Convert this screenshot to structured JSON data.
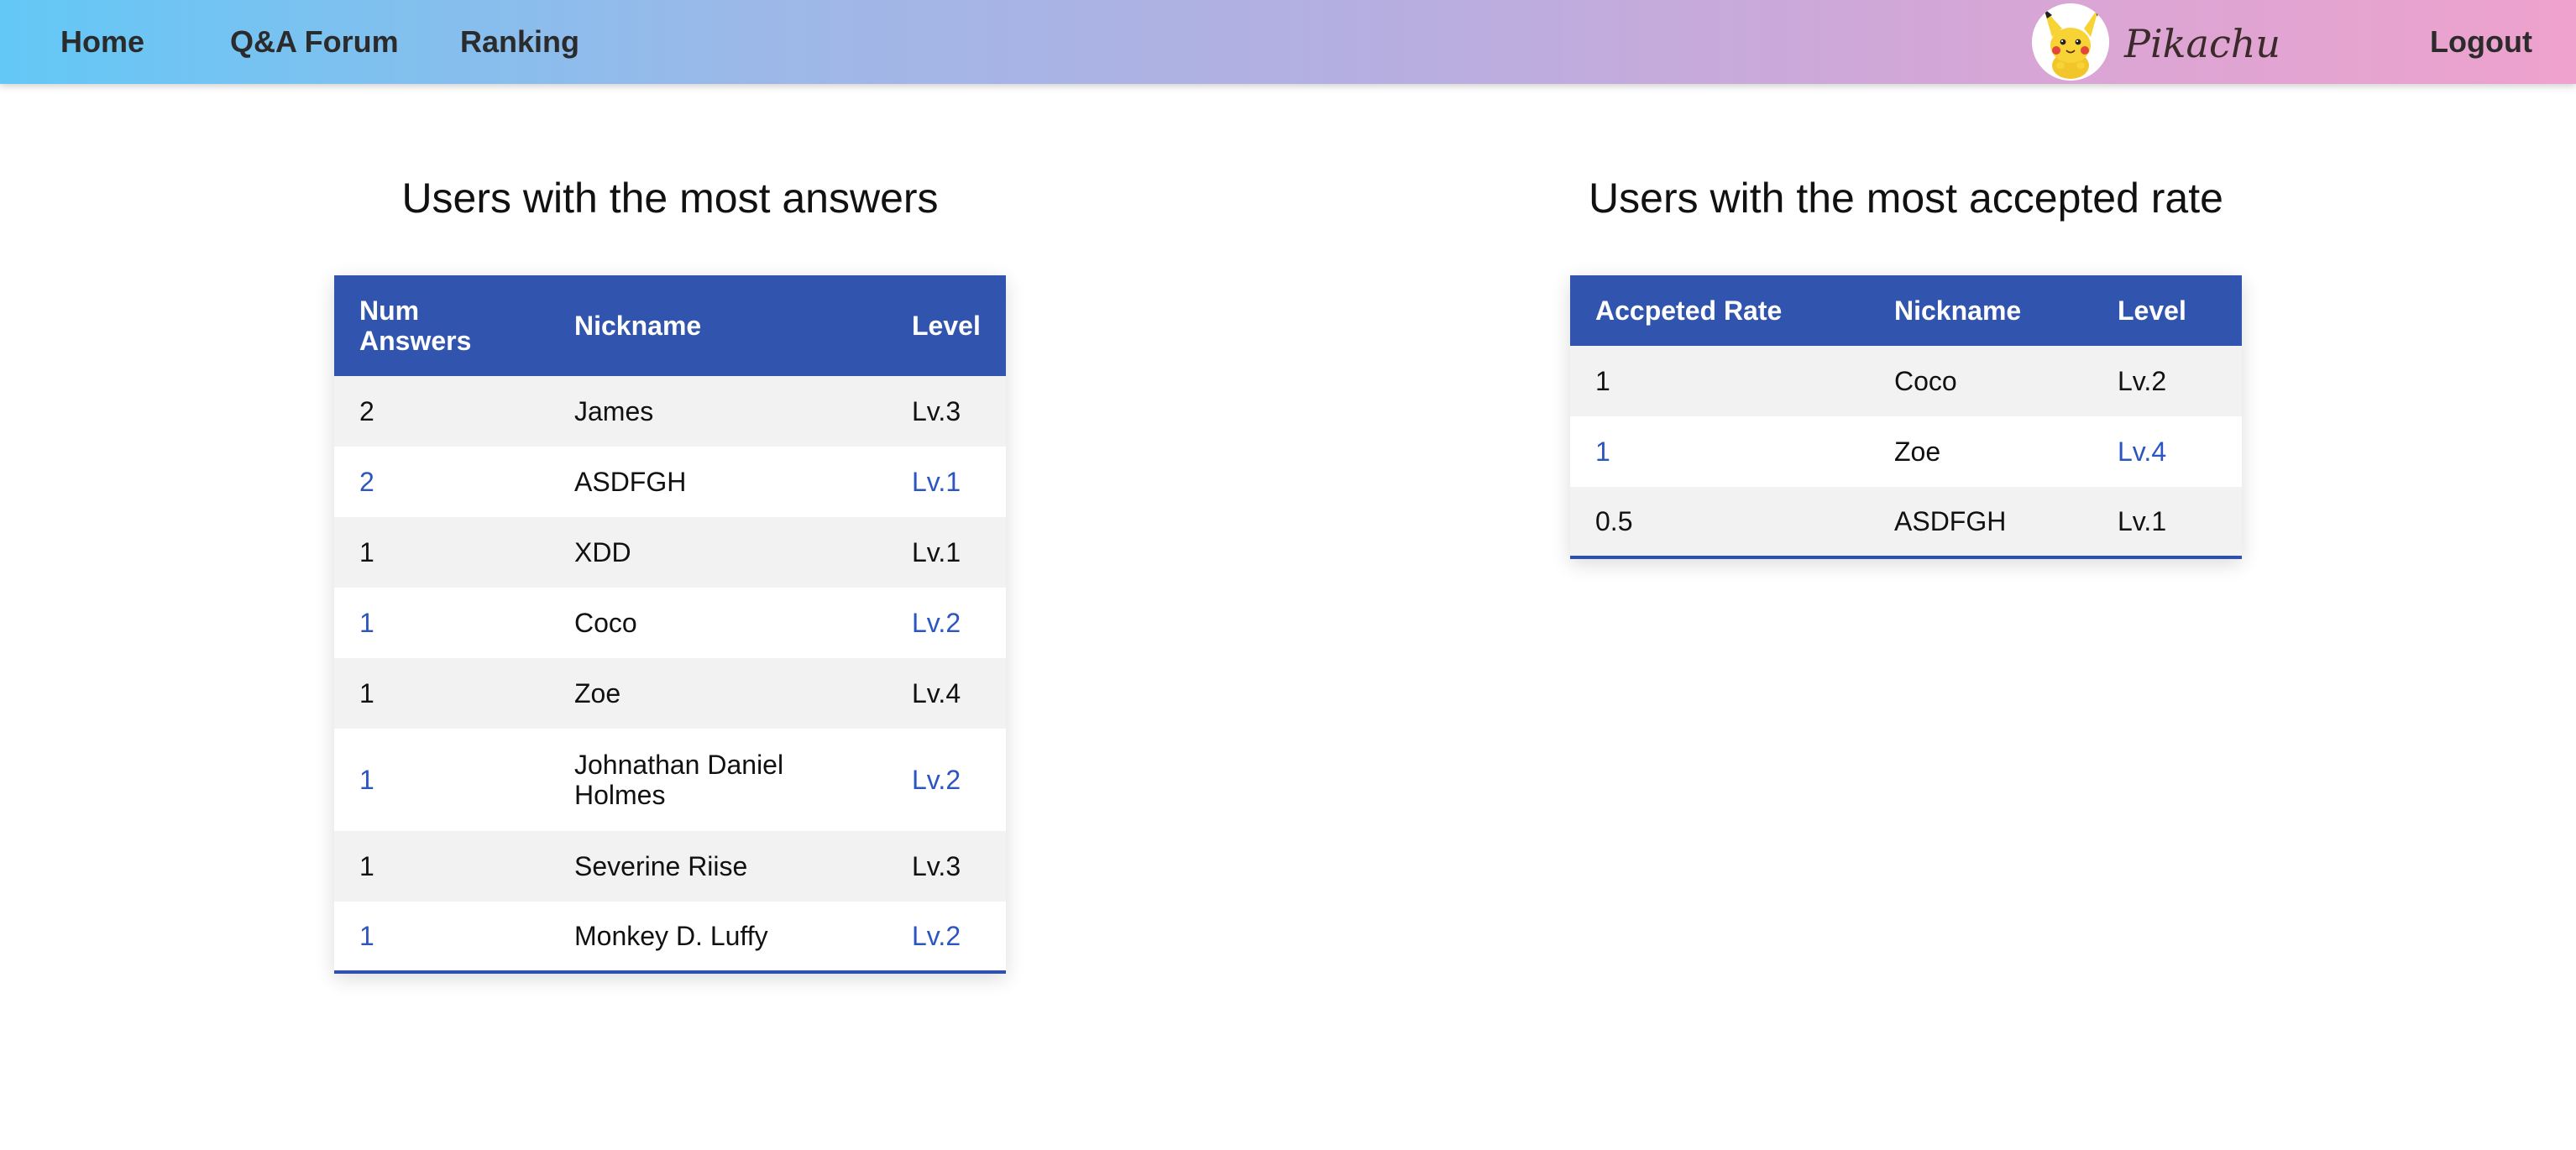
{
  "nav": {
    "home": "Home",
    "qa_forum": "Q&A Forum",
    "ranking": "Ranking",
    "brand": "Pikachu",
    "logout": "Logout",
    "logo_icon": "pikachu-avatar-icon"
  },
  "colors": {
    "header_blue": "#3155ae",
    "link_blue": "#2b55c0",
    "row_alt": "#f2f2f2"
  },
  "answers": {
    "title": "Users with the most answers",
    "headers": [
      "Num Answers",
      "Nickname",
      "Level"
    ],
    "rows": [
      {
        "num": "2",
        "nickname": "James",
        "level": "Lv.3"
      },
      {
        "num": "2",
        "nickname": "ASDFGH",
        "level": "Lv.1"
      },
      {
        "num": "1",
        "nickname": "XDD",
        "level": "Lv.1"
      },
      {
        "num": "1",
        "nickname": "Coco",
        "level": "Lv.2"
      },
      {
        "num": "1",
        "nickname": "Zoe",
        "level": "Lv.4"
      },
      {
        "num": "1",
        "nickname": "Johnathan Daniel Holmes",
        "level": "Lv.2"
      },
      {
        "num": "1",
        "nickname": "Severine Riise",
        "level": "Lv.3"
      },
      {
        "num": "1",
        "nickname": "Monkey D. Luffy",
        "level": "Lv.2"
      }
    ]
  },
  "accepted": {
    "title": "Users with the most accepted rate",
    "headers": [
      "Accpeted Rate",
      "Nickname",
      "Level"
    ],
    "rows": [
      {
        "rate": "1",
        "nickname": "Coco",
        "level": "Lv.2"
      },
      {
        "rate": "1",
        "nickname": "Zoe",
        "level": "Lv.4"
      },
      {
        "rate": "0.5",
        "nickname": "ASDFGH",
        "level": "Lv.1"
      }
    ]
  }
}
